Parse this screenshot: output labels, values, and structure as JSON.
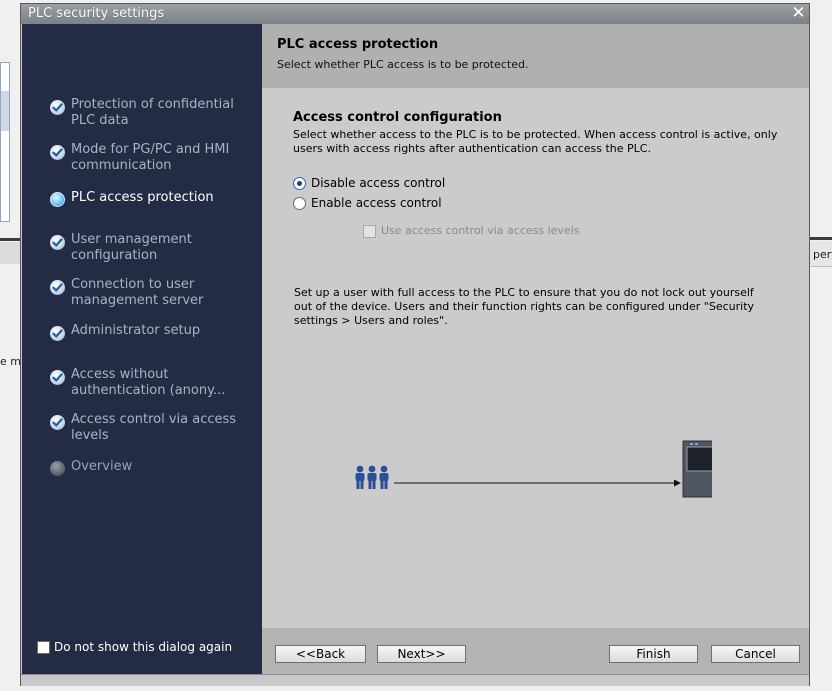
{
  "background": {
    "left_text": "e m",
    "right_text": "pert"
  },
  "dialog": {
    "title": "PLC security settings",
    "close_glyph": "✕"
  },
  "sidebar": {
    "items": [
      {
        "label": "Protection of confidential PLC data",
        "state": "done"
      },
      {
        "label": "Mode for PG/PC and HMI communication",
        "state": "done"
      },
      {
        "label": "PLC access protection",
        "state": "active"
      },
      {
        "label": "User management configuration",
        "state": "done"
      },
      {
        "label": "Connection to user management server",
        "state": "done"
      },
      {
        "label": "Administrator setup",
        "state": "done"
      },
      {
        "label": "Access without authentication (anony...",
        "state": "done"
      },
      {
        "label": "Access control via access levels",
        "state": "done"
      },
      {
        "label": "Overview",
        "state": "pending"
      }
    ],
    "dont_show_label": "Do not show this dialog again",
    "dont_show_checked": false
  },
  "header": {
    "title": "PLC access protection",
    "subtitle": "Select whether PLC access is to be protected."
  },
  "content": {
    "section_title": "Access control configuration",
    "section_desc": "Select whether access to the PLC is to be protected. When access control is active, only users with access rights after authentication can access the PLC.",
    "options": [
      {
        "label": "Disable access control",
        "checked": true
      },
      {
        "label": "Enable access control",
        "checked": false
      }
    ],
    "sub_option": {
      "label": "Use access control via access levels",
      "enabled": false,
      "checked": false
    },
    "note": "Set up a user with full access to the PLC to ensure that you do not lock out yourself out of the device. Users and their function rights can be configured under \"Security settings > Users and roles\"."
  },
  "footer": {
    "back_label": "<<Back",
    "next_label": "Next>>",
    "finish_label": "Finish",
    "cancel_label": "Cancel"
  },
  "colors": {
    "sidebar_bg": "#242c45",
    "active_text": "#ffffff",
    "inactive_text": "#a9b3c3",
    "header_bg": "#b0b0b0",
    "content_bg": "#cbcbcb"
  }
}
